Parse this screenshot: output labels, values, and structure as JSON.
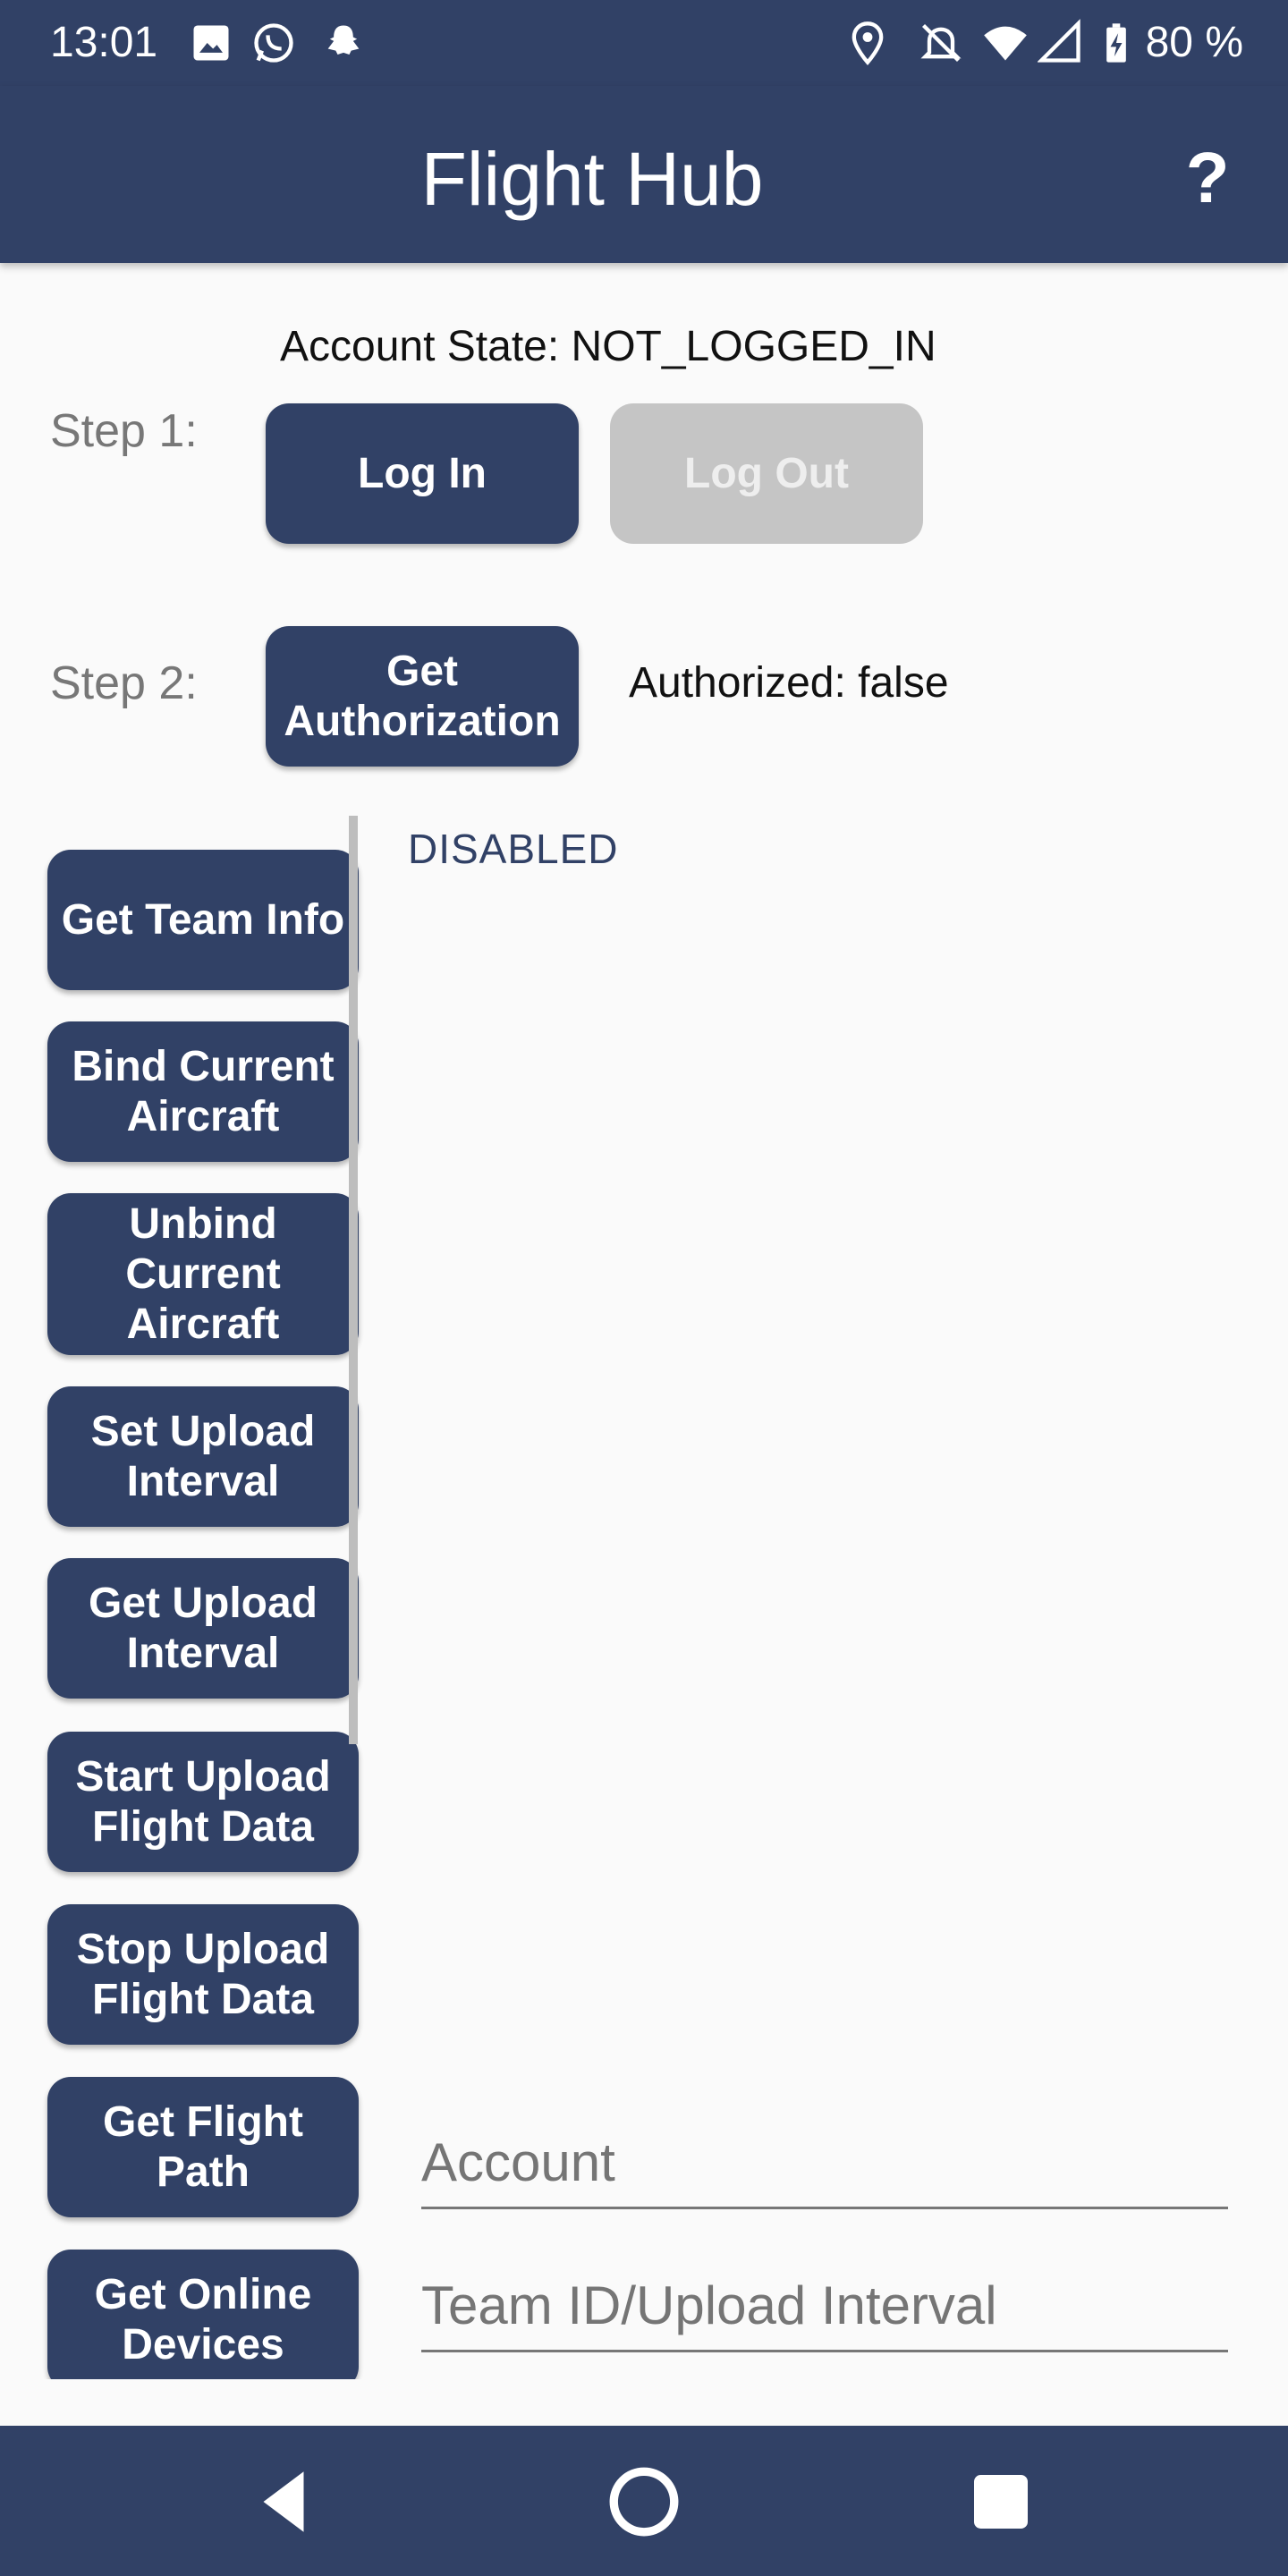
{
  "status_bar": {
    "time": "13:01",
    "icons": [
      "image-icon",
      "whatsapp-icon",
      "snapchat-icon",
      "location-icon",
      "notifications-off-icon",
      "wifi-icon",
      "cellular-icon",
      "battery-charging-icon"
    ],
    "battery": "80 %"
  },
  "app_bar": {
    "title": "Flight Hub",
    "help_label": "?"
  },
  "account": {
    "state": "Account State: NOT_LOGGED_IN"
  },
  "step1": {
    "label": "Step 1:",
    "login": "Log In",
    "logout": "Log Out"
  },
  "step2": {
    "label": "Step 2:",
    "get_authorization": "Get Authorization",
    "authorized": "Authorized: false"
  },
  "actions": [
    {
      "label": "Get Team Info"
    },
    {
      "label": "Bind Current Aircraft"
    },
    {
      "label": "Unbind Current Aircraft"
    },
    {
      "label": "Set Upload Interval"
    },
    {
      "label": "Get Upload Interval"
    },
    {
      "label": "Start Upload Flight Data"
    },
    {
      "label": "Stop Upload Flight Data"
    },
    {
      "label": "Get Flight Path"
    },
    {
      "label": "Get Online Devices"
    }
  ],
  "result": "DISABLED",
  "inputs": {
    "account_placeholder": "Account",
    "team_placeholder": "Team ID/Upload Interval"
  },
  "colors": {
    "primary": "#314166",
    "disabled": "#c5c5c5",
    "background": "#fafafa"
  }
}
